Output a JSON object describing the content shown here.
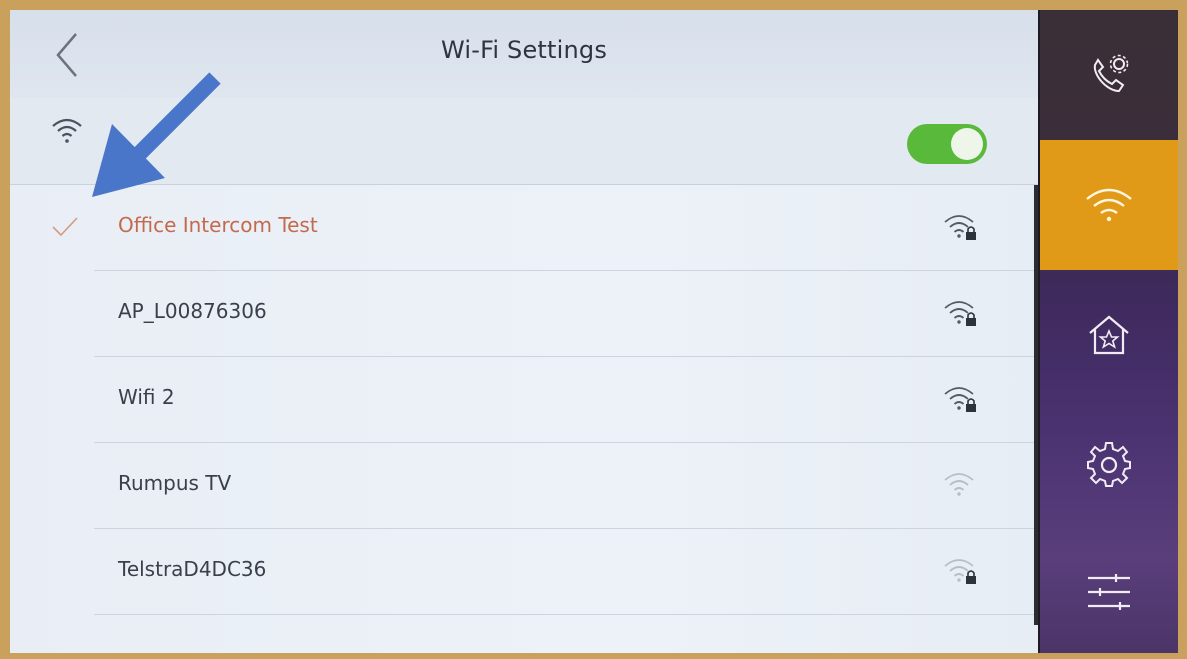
{
  "header": {
    "title": "Wi-Fi Settings"
  },
  "wifi_toggle": {
    "enabled": true
  },
  "networks": [
    {
      "name": "Office Intercom Test",
      "connected": true,
      "secured": true,
      "signal": "strong"
    },
    {
      "name": "AP_L00876306",
      "connected": false,
      "secured": true,
      "signal": "strong"
    },
    {
      "name": "Wifi 2",
      "connected": false,
      "secured": true,
      "signal": "strong"
    },
    {
      "name": "Rumpus TV",
      "connected": false,
      "secured": false,
      "signal": "weak"
    },
    {
      "name": "TelstraD4DC36",
      "connected": false,
      "secured": true,
      "signal": "weak"
    }
  ],
  "sidebar": {
    "items": [
      {
        "icon": "phone-settings-icon",
        "active": false
      },
      {
        "icon": "wifi-icon",
        "active": true
      },
      {
        "icon": "home-star-icon",
        "active": false
      },
      {
        "icon": "gear-icon",
        "active": false
      },
      {
        "icon": "sliders-icon",
        "active": false
      }
    ]
  },
  "colors": {
    "accent": "#e09a17",
    "toggle_on": "#58b93b",
    "connected_text": "#c46a4c",
    "annotation_arrow": "#4a76c9"
  }
}
